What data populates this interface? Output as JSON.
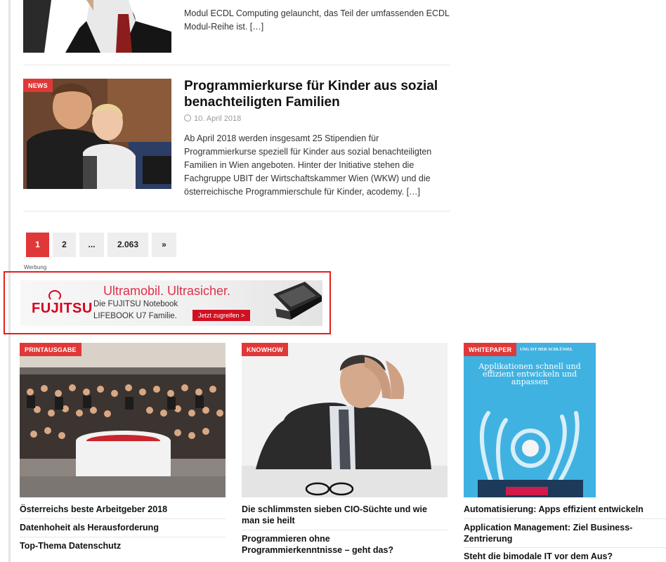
{
  "top_article": {
    "excerpt": "Modul ECDL Computing gelauncht, das Teil der umfassenden ECDL Modul-Reihe ist. […]"
  },
  "article": {
    "tag": "NEWS",
    "title": "Programmierkurse für Kinder aus sozial benachteiligten Familien",
    "date": "10. April 2018",
    "excerpt": "Ab April 2018 werden insgesamt 25 Stipendien für Programmierkurse speziell für Kinder aus sozial benachteiligten Familien in Wien angeboten. Hinter der Initiative stehen die Fachgruppe UBIT der Wirtschaftskammer Wien (WKW) und die österreichische Programmierschule für Kinder, acodemy. […]"
  },
  "pagination": {
    "items": [
      "1",
      "2",
      "...",
      "2.063",
      "»"
    ],
    "current": "1"
  },
  "ad": {
    "label": "Werbung",
    "brand": "FUJITSU",
    "headline": "Ultramobil. Ultrasicher.",
    "line1": "Die FUJITSU Notebook",
    "line2": "LIFEBOOK U7 Familie.",
    "cta": "Jetzt zugreifen >"
  },
  "cards": [
    {
      "tag": "PRINTAUSGABE",
      "links": [
        "Österreichs beste Arbeitgeber 2018",
        "Datenhoheit als Herausforderung",
        "Top-Thema Datenschutz"
      ]
    },
    {
      "tag": "KNOWHOW",
      "links": [
        "Die schlimmsten sieben CIO-Süchte und wie man sie heilt",
        "Programmieren ohne Programmierkenntnisse – geht das?"
      ]
    },
    {
      "tag": "WHITEPAPER",
      "cover_kicker": "UNG IST DER SCHLÜSSEL",
      "cover_title": "Applikationen schnell und effizient entwickeln und anpassen",
      "links": [
        "Automatisierung: Apps effizient entwickeln",
        "Application Management: Ziel Business-Zentrierung",
        "Steht die bimodale IT vor dem Aus?"
      ]
    }
  ],
  "colors": {
    "accent": "#e03838",
    "ad_red": "#d8001f"
  }
}
